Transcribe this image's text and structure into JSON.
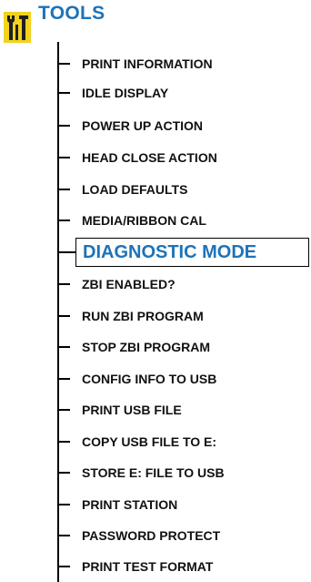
{
  "header": {
    "title": "TOOLS",
    "icon": "tools-icon"
  },
  "menu": {
    "items": [
      {
        "label": "PRINT INFORMATION"
      },
      {
        "label": "IDLE DISPLAY"
      },
      {
        "label": "POWER UP ACTION"
      },
      {
        "label": "HEAD CLOSE ACTION"
      },
      {
        "label": "LOAD DEFAULTS"
      },
      {
        "label": "MEDIA/RIBBON CAL"
      },
      {
        "label": "DIAGNOSTIC MODE",
        "selected": true
      },
      {
        "label": "ZBI ENABLED?"
      },
      {
        "label": "RUN ZBI PROGRAM"
      },
      {
        "label": "STOP ZBI PROGRAM"
      },
      {
        "label": "CONFIG INFO TO USB"
      },
      {
        "label": "PRINT USB FILE"
      },
      {
        "label": "COPY USB FILE TO E:"
      },
      {
        "label": "STORE E: FILE TO USB"
      },
      {
        "label": "PRINT STATION"
      },
      {
        "label": "PASSWORD PROTECT"
      },
      {
        "label": "PRINT TEST FORMAT"
      }
    ]
  },
  "colors": {
    "accent": "#1d73b8",
    "icon_bg": "#f2d21c",
    "icon_fg": "#1f1f1f"
  }
}
